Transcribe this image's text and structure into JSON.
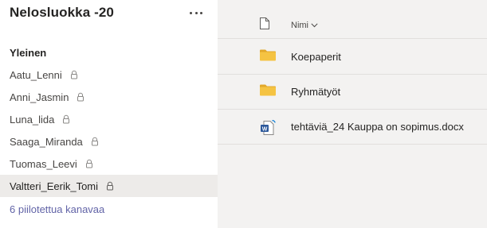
{
  "team": {
    "name": "Nelosluokka -20"
  },
  "sidebar": {
    "section_label": "Yleinen",
    "channels": [
      {
        "label": "Aatu_Lenni",
        "private": true
      },
      {
        "label": "Anni_Jasmin",
        "private": true
      },
      {
        "label": "Luna_lida",
        "private": true
      },
      {
        "label": "Saaga_Miranda",
        "private": true
      },
      {
        "label": "Tuomas_Leevi",
        "private": true
      },
      {
        "label": "Valtteri_Eerik_Tomi",
        "private": true,
        "selected": true
      }
    ],
    "hidden_channels_link": "6 piilotettua kanavaa"
  },
  "files": {
    "column_name": "Nimi",
    "items": [
      {
        "name": "Koepaperit",
        "type": "folder-icon"
      },
      {
        "name": "Ryhmätyöt",
        "type": "folder-icon"
      },
      {
        "name": "tehtäviä_24 Kauppa on sopimus.docx",
        "type": "word-document-icon"
      }
    ]
  },
  "colors": {
    "accent": "#6264a7",
    "folder": "#f5c342",
    "word": "#2b579a",
    "selected_row": "#edebe9",
    "panel_bg": "#f3f2f1"
  }
}
